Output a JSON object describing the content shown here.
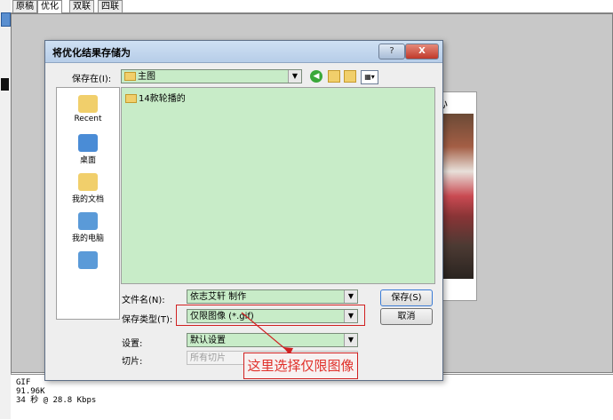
{
  "tabs": [
    "原稿",
    "优化",
    "双联",
    "四联"
  ],
  "active_tab": "优化",
  "preview": {
    "photo_text": "心"
  },
  "status": {
    "lines": [
      "GIF",
      "91.96K",
      "34 秒 @ 28.8 Kbps"
    ]
  },
  "dialog": {
    "title": "将优化结果存储为",
    "help_label": "?",
    "close_label": "X",
    "save_in_label": "保存在(I):",
    "save_in_value": "主图",
    "places": [
      "Recent",
      "桌面",
      "我的文档",
      "我的电脑",
      ""
    ],
    "files": [
      {
        "name": "14款轮播的"
      }
    ],
    "filename_label": "文件名(N):",
    "filename_value": "依志艾轩 制作",
    "filetype_label": "保存类型(T):",
    "filetype_value": "仅限图像 (*.gif)",
    "settings_label": "设置:",
    "settings_value": "默认设置",
    "slices_label": "切片:",
    "slices_value": "所有切片",
    "save_button": "保存(S)",
    "cancel_button": "取消"
  },
  "annotation": {
    "text": "这里选择仅限图像",
    "color": "#e0302a"
  },
  "colors": {
    "list_bg": "#c8ecc8",
    "title_bar": "#b7cde8",
    "annotation": "#d02020"
  }
}
